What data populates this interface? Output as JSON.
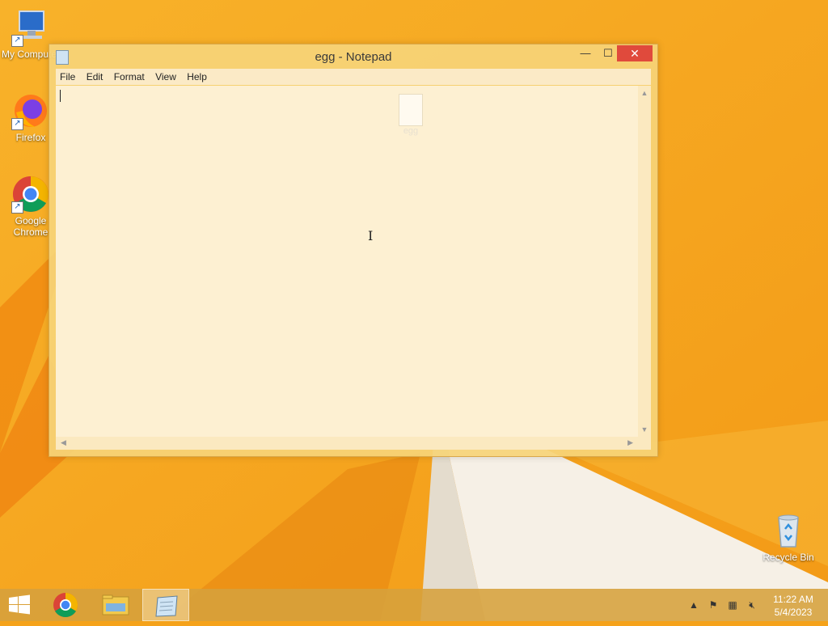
{
  "desktop": {
    "icons": [
      {
        "label": "My Computer",
        "icon": "computer-icon"
      },
      {
        "label": "Firefox",
        "icon": "firefox-icon"
      },
      {
        "label": "Google Chrome",
        "icon": "chrome-icon"
      },
      {
        "label": "Recycle Bin",
        "icon": "recycle-bin-icon"
      }
    ],
    "file_icon": {
      "label": "egg",
      "icon": "text-file-icon"
    }
  },
  "notepad": {
    "title": "egg - Notepad",
    "controls": {
      "minimize": "—",
      "maximize": "☐",
      "close": "✕"
    },
    "menu": [
      "File",
      "Edit",
      "Format",
      "View",
      "Help"
    ],
    "content": ""
  },
  "taskbar": {
    "pinned": [
      "start-icon",
      "chrome-icon",
      "file-explorer-icon",
      "notepad-icon"
    ],
    "active": "notepad-icon",
    "tray": [
      "show-hidden-icons-icon",
      "action-center-flag-icon",
      "network-icon",
      "volume-muted-icon"
    ],
    "time": "11:22 AM",
    "date": "5/4/2023"
  },
  "colors": {
    "wallpaper": "#f5a21a",
    "close_button": "#e04a3c"
  }
}
